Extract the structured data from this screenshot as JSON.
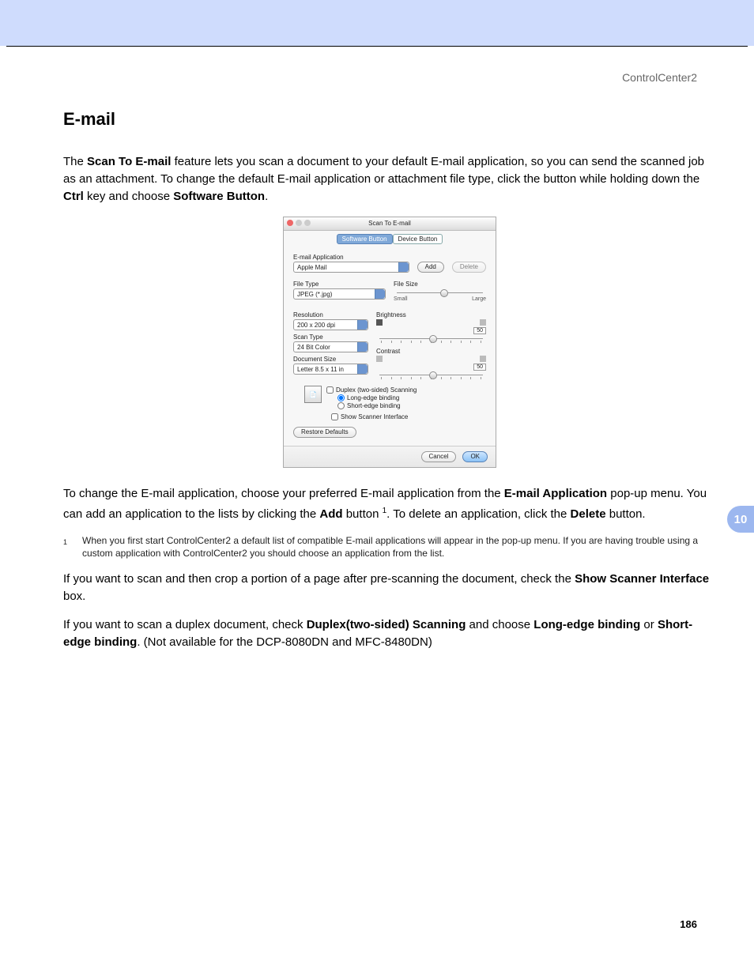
{
  "header": {
    "product": "ControlCenter2"
  },
  "section": {
    "title": "E-mail"
  },
  "paras": {
    "p1a": "The ",
    "p1b": "Scan To E-mail",
    "p1c": " feature lets you scan a document to your default E-mail application, so you can send the scanned job as an attachment. To change the default E-mail application or attachment file type, click the button while holding down the ",
    "p1d": "Ctrl",
    "p1e": " key and choose ",
    "p1f": "Software Button",
    "p1g": ".",
    "p2a": "To change the E-mail application, choose your preferred E-mail application from the ",
    "p2b": "E-mail Application",
    "p2c": " pop-up menu. You can add an application to the lists by clicking the ",
    "p2d": "Add",
    "p2e": " button ",
    "p2f": "1",
    "p2g": ". To delete an application, click the ",
    "p2h": "Delete",
    "p2i": " button.",
    "fnum": "1",
    "ftext": "When you first start ControlCenter2 a default list of compatible E-mail applications will appear in the pop-up menu. If you are having trouble using a custom application with ControlCenter2 you should choose an application from the list.",
    "p3a": "If you want to scan and then crop a portion of a page after pre-scanning the document, check the ",
    "p3b": "Show Scanner Interface",
    "p3c": " box.",
    "p4a": "If you want to scan a duplex document, check ",
    "p4b": "Duplex(two-sided) Scanning",
    "p4c": " and choose ",
    "p4d": "Long-edge binding",
    "p4e": " or ",
    "p4f": "Short-edge binding",
    "p4g": ". (Not available for the DCP-8080DN and MFC-8480DN)"
  },
  "dialog": {
    "title": "Scan To E-mail",
    "tabs": {
      "software": "Software Button",
      "device": "Device Button"
    },
    "labels": {
      "emailapp": "E-mail Application",
      "filetype": "File Type",
      "filesize": "File Size",
      "small": "Small",
      "large": "Large",
      "resolution": "Resolution",
      "scantype": "Scan Type",
      "docsize": "Document Size",
      "brightness": "Brightness",
      "contrast": "Contrast",
      "duplex": "Duplex (two-sided) Scanning",
      "longedge": "Long-edge binding",
      "shortedge": "Short-edge binding",
      "showscanner": "Show Scanner Interface"
    },
    "values": {
      "emailapp": "Apple Mail",
      "filetype": "JPEG (*.jpg)",
      "resolution": "200 x 200 dpi",
      "scantype": "24 Bit Color",
      "docsize": "Letter  8.5 x 11 in",
      "brightness": "50",
      "contrast": "50"
    },
    "buttons": {
      "add": "Add",
      "delete": "Delete",
      "restore": "Restore Defaults",
      "cancel": "Cancel",
      "ok": "OK"
    }
  },
  "chapter": "10",
  "pagenum": "186"
}
